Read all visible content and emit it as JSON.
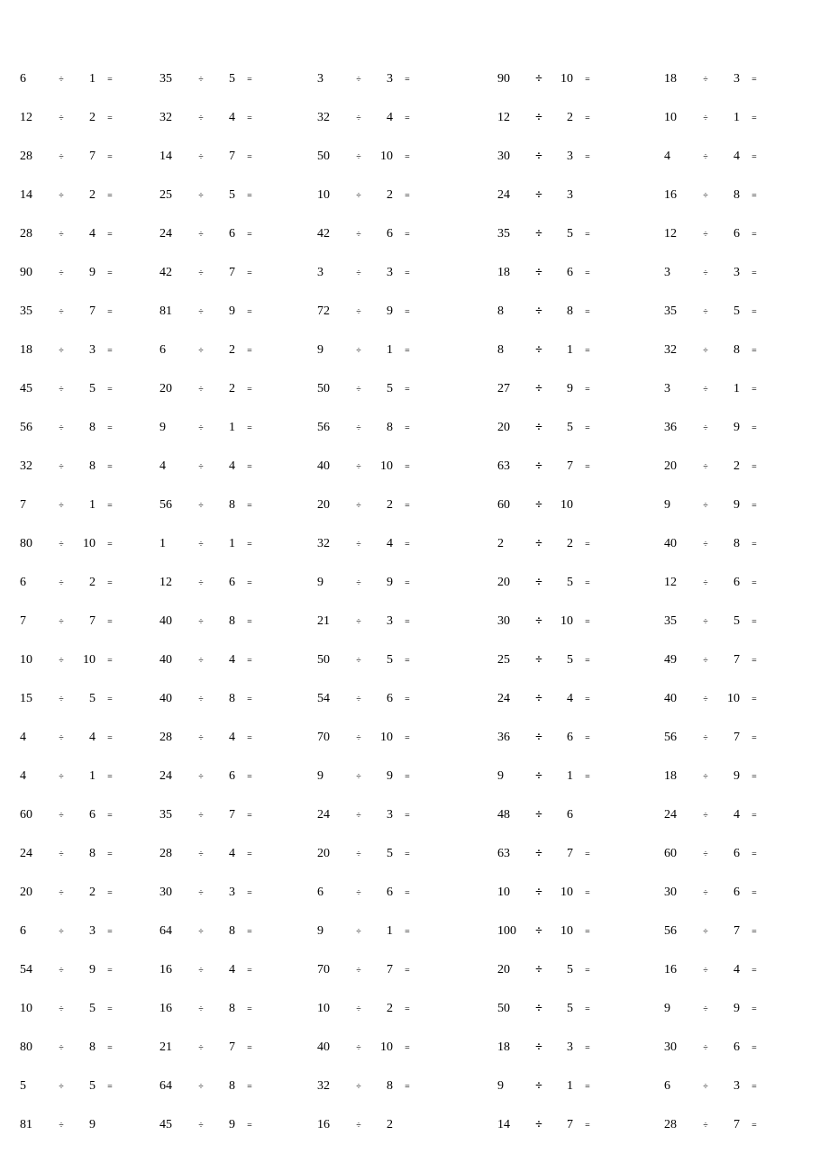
{
  "worksheet": {
    "rows": [
      [
        {
          "a": "6",
          "op": "÷",
          "b": "1",
          "eq": "="
        },
        {
          "a": "35",
          "op": "÷",
          "b": "5",
          "eq": "="
        },
        {
          "a": "3",
          "op": "÷",
          "b": "3",
          "eq": "="
        },
        {
          "a": "90",
          "op": "÷",
          "b": "10",
          "eq": "="
        },
        {
          "a": "18",
          "op": "÷",
          "b": "3",
          "eq": "="
        }
      ],
      [
        {
          "a": "12",
          "op": "÷",
          "b": "2",
          "eq": "="
        },
        {
          "a": "32",
          "op": "÷",
          "b": "4",
          "eq": "="
        },
        {
          "a": "32",
          "op": "÷",
          "b": "4",
          "eq": "="
        },
        {
          "a": "12",
          "op": "÷",
          "b": "2",
          "eq": "="
        },
        {
          "a": "10",
          "op": "÷",
          "b": "1",
          "eq": "="
        }
      ],
      [
        {
          "a": "28",
          "op": "÷",
          "b": "7",
          "eq": "="
        },
        {
          "a": "14",
          "op": "÷",
          "b": "7",
          "eq": "="
        },
        {
          "a": "50",
          "op": "÷",
          "b": "10",
          "eq": "="
        },
        {
          "a": "30",
          "op": "÷",
          "b": "3",
          "eq": "="
        },
        {
          "a": "4",
          "op": "÷",
          "b": "4",
          "eq": "="
        }
      ],
      [
        {
          "a": "14",
          "op": "÷",
          "b": "2",
          "eq": "="
        },
        {
          "a": "25",
          "op": "÷",
          "b": "5",
          "eq": "="
        },
        {
          "a": "10",
          "op": "÷",
          "b": "2",
          "eq": "="
        },
        {
          "a": "24",
          "op": "÷",
          "b": "3",
          "eq": ""
        },
        {
          "a": "16",
          "op": "÷",
          "b": "8",
          "eq": "="
        }
      ],
      [
        {
          "a": "28",
          "op": "÷",
          "b": "4",
          "eq": "="
        },
        {
          "a": "24",
          "op": "÷",
          "b": "6",
          "eq": "="
        },
        {
          "a": "42",
          "op": "÷",
          "b": "6",
          "eq": "="
        },
        {
          "a": "35",
          "op": "÷",
          "b": "5",
          "eq": "="
        },
        {
          "a": "12",
          "op": "÷",
          "b": "6",
          "eq": "="
        }
      ],
      [
        {
          "a": "90",
          "op": "÷",
          "b": "9",
          "eq": "="
        },
        {
          "a": "42",
          "op": "÷",
          "b": "7",
          "eq": "="
        },
        {
          "a": "3",
          "op": "÷",
          "b": "3",
          "eq": "="
        },
        {
          "a": "18",
          "op": "÷",
          "b": "6",
          "eq": "="
        },
        {
          "a": "3",
          "op": "÷",
          "b": "3",
          "eq": "="
        }
      ],
      [
        {
          "a": "35",
          "op": "÷",
          "b": "7",
          "eq": "="
        },
        {
          "a": "81",
          "op": "÷",
          "b": "9",
          "eq": "="
        },
        {
          "a": "72",
          "op": "÷",
          "b": "9",
          "eq": "="
        },
        {
          "a": "8",
          "op": "÷",
          "b": "8",
          "eq": "="
        },
        {
          "a": "35",
          "op": "÷",
          "b": "5",
          "eq": "="
        }
      ],
      [
        {
          "a": "18",
          "op": "÷",
          "b": "3",
          "eq": "="
        },
        {
          "a": "6",
          "op": "÷",
          "b": "2",
          "eq": "="
        },
        {
          "a": "9",
          "op": "÷",
          "b": "1",
          "eq": "="
        },
        {
          "a": "8",
          "op": "÷",
          "b": "1",
          "eq": "="
        },
        {
          "a": "32",
          "op": "÷",
          "b": "8",
          "eq": "="
        }
      ],
      [
        {
          "a": "45",
          "op": "÷",
          "b": "5",
          "eq": "="
        },
        {
          "a": "20",
          "op": "÷",
          "b": "2",
          "eq": "="
        },
        {
          "a": "50",
          "op": "÷",
          "b": "5",
          "eq": "="
        },
        {
          "a": "27",
          "op": "÷",
          "b": "9",
          "eq": "="
        },
        {
          "a": "3",
          "op": "÷",
          "b": "1",
          "eq": "="
        }
      ],
      [
        {
          "a": "56",
          "op": "÷",
          "b": "8",
          "eq": "="
        },
        {
          "a": "9",
          "op": "÷",
          "b": "1",
          "eq": "="
        },
        {
          "a": "56",
          "op": "÷",
          "b": "8",
          "eq": "="
        },
        {
          "a": "20",
          "op": "÷",
          "b": "5",
          "eq": "="
        },
        {
          "a": "36",
          "op": "÷",
          "b": "9",
          "eq": "="
        }
      ],
      [
        {
          "a": "32",
          "op": "÷",
          "b": "8",
          "eq": "="
        },
        {
          "a": "4",
          "op": "÷",
          "b": "4",
          "eq": "="
        },
        {
          "a": "40",
          "op": "÷",
          "b": "10",
          "eq": "="
        },
        {
          "a": "63",
          "op": "÷",
          "b": "7",
          "eq": "="
        },
        {
          "a": "20",
          "op": "÷",
          "b": "2",
          "eq": "="
        }
      ],
      [
        {
          "a": "7",
          "op": "÷",
          "b": "1",
          "eq": "="
        },
        {
          "a": "56",
          "op": "÷",
          "b": "8",
          "eq": "="
        },
        {
          "a": "20",
          "op": "÷",
          "b": "2",
          "eq": "="
        },
        {
          "a": "60",
          "op": "÷",
          "b": "10",
          "eq": ""
        },
        {
          "a": "9",
          "op": "÷",
          "b": "9",
          "eq": "="
        }
      ],
      [
        {
          "a": "80",
          "op": "÷",
          "b": "10",
          "eq": "="
        },
        {
          "a": "1",
          "op": "÷",
          "b": "1",
          "eq": "="
        },
        {
          "a": "32",
          "op": "÷",
          "b": "4",
          "eq": "="
        },
        {
          "a": "2",
          "op": "÷",
          "b": "2",
          "eq": "="
        },
        {
          "a": "40",
          "op": "÷",
          "b": "8",
          "eq": "="
        }
      ],
      [
        {
          "a": "6",
          "op": "÷",
          "b": "2",
          "eq": "="
        },
        {
          "a": "12",
          "op": "÷",
          "b": "6",
          "eq": "="
        },
        {
          "a": "9",
          "op": "÷",
          "b": "9",
          "eq": "="
        },
        {
          "a": "20",
          "op": "÷",
          "b": "5",
          "eq": "="
        },
        {
          "a": "12",
          "op": "÷",
          "b": "6",
          "eq": "="
        }
      ],
      [
        {
          "a": "7",
          "op": "÷",
          "b": "7",
          "eq": "="
        },
        {
          "a": "40",
          "op": "÷",
          "b": "8",
          "eq": "="
        },
        {
          "a": "21",
          "op": "÷",
          "b": "3",
          "eq": "="
        },
        {
          "a": "30",
          "op": "÷",
          "b": "10",
          "eq": "="
        },
        {
          "a": "35",
          "op": "÷",
          "b": "5",
          "eq": "="
        }
      ],
      [
        {
          "a": "10",
          "op": "÷",
          "b": "10",
          "eq": "="
        },
        {
          "a": "40",
          "op": "÷",
          "b": "4",
          "eq": "="
        },
        {
          "a": "50",
          "op": "÷",
          "b": "5",
          "eq": "="
        },
        {
          "a": "25",
          "op": "÷",
          "b": "5",
          "eq": "="
        },
        {
          "a": "49",
          "op": "÷",
          "b": "7",
          "eq": "="
        }
      ],
      [
        {
          "a": "15",
          "op": "÷",
          "b": "5",
          "eq": "="
        },
        {
          "a": "40",
          "op": "÷",
          "b": "8",
          "eq": "="
        },
        {
          "a": "54",
          "op": "÷",
          "b": "6",
          "eq": "="
        },
        {
          "a": "24",
          "op": "÷",
          "b": "4",
          "eq": "="
        },
        {
          "a": "40",
          "op": "÷",
          "b": "10",
          "eq": "="
        }
      ],
      [
        {
          "a": "4",
          "op": "÷",
          "b": "4",
          "eq": "="
        },
        {
          "a": "28",
          "op": "÷",
          "b": "4",
          "eq": "="
        },
        {
          "a": "70",
          "op": "÷",
          "b": "10",
          "eq": "="
        },
        {
          "a": "36",
          "op": "÷",
          "b": "6",
          "eq": "="
        },
        {
          "a": "56",
          "op": "÷",
          "b": "7",
          "eq": "="
        }
      ],
      [
        {
          "a": "4",
          "op": "÷",
          "b": "1",
          "eq": "="
        },
        {
          "a": "24",
          "op": "÷",
          "b": "6",
          "eq": "="
        },
        {
          "a": "9",
          "op": "÷",
          "b": "9",
          "eq": "="
        },
        {
          "a": "9",
          "op": "÷",
          "b": "1",
          "eq": "="
        },
        {
          "a": "18",
          "op": "÷",
          "b": "9",
          "eq": "="
        }
      ],
      [
        {
          "a": "60",
          "op": "÷",
          "b": "6",
          "eq": "="
        },
        {
          "a": "35",
          "op": "÷",
          "b": "7",
          "eq": "="
        },
        {
          "a": "24",
          "op": "÷",
          "b": "3",
          "eq": "="
        },
        {
          "a": "48",
          "op": "÷",
          "b": "6",
          "eq": ""
        },
        {
          "a": "24",
          "op": "÷",
          "b": "4",
          "eq": "="
        }
      ],
      [
        {
          "a": "24",
          "op": "÷",
          "b": "8",
          "eq": "="
        },
        {
          "a": "28",
          "op": "÷",
          "b": "4",
          "eq": "="
        },
        {
          "a": "20",
          "op": "÷",
          "b": "5",
          "eq": "="
        },
        {
          "a": "63",
          "op": "÷",
          "b": "7",
          "eq": "="
        },
        {
          "a": "60",
          "op": "÷",
          "b": "6",
          "eq": "="
        }
      ],
      [
        {
          "a": "20",
          "op": "÷",
          "b": "2",
          "eq": "="
        },
        {
          "a": "30",
          "op": "÷",
          "b": "3",
          "eq": "="
        },
        {
          "a": "6",
          "op": "÷",
          "b": "6",
          "eq": "="
        },
        {
          "a": "10",
          "op": "÷",
          "b": "10",
          "eq": "="
        },
        {
          "a": "30",
          "op": "÷",
          "b": "6",
          "eq": "="
        }
      ],
      [
        {
          "a": "6",
          "op": "÷",
          "b": "3",
          "eq": "="
        },
        {
          "a": "64",
          "op": "÷",
          "b": "8",
          "eq": "="
        },
        {
          "a": "9",
          "op": "÷",
          "b": "1",
          "eq": "="
        },
        {
          "a": "100",
          "op": "÷",
          "b": "10",
          "eq": "="
        },
        {
          "a": "56",
          "op": "÷",
          "b": "7",
          "eq": "="
        }
      ],
      [
        {
          "a": "54",
          "op": "÷",
          "b": "9",
          "eq": "="
        },
        {
          "a": "16",
          "op": "÷",
          "b": "4",
          "eq": "="
        },
        {
          "a": "70",
          "op": "÷",
          "b": "7",
          "eq": "="
        },
        {
          "a": "20",
          "op": "÷",
          "b": "5",
          "eq": "="
        },
        {
          "a": "16",
          "op": "÷",
          "b": "4",
          "eq": "="
        }
      ],
      [
        {
          "a": "10",
          "op": "÷",
          "b": "5",
          "eq": "="
        },
        {
          "a": "16",
          "op": "÷",
          "b": "8",
          "eq": "="
        },
        {
          "a": "10",
          "op": "÷",
          "b": "2",
          "eq": "="
        },
        {
          "a": "50",
          "op": "÷",
          "b": "5",
          "eq": "="
        },
        {
          "a": "9",
          "op": "÷",
          "b": "9",
          "eq": "="
        }
      ],
      [
        {
          "a": "80",
          "op": "÷",
          "b": "8",
          "eq": "="
        },
        {
          "a": "21",
          "op": "÷",
          "b": "7",
          "eq": "="
        },
        {
          "a": "40",
          "op": "÷",
          "b": "10",
          "eq": "="
        },
        {
          "a": "18",
          "op": "÷",
          "b": "3",
          "eq": "="
        },
        {
          "a": "30",
          "op": "÷",
          "b": "6",
          "eq": "="
        }
      ],
      [
        {
          "a": "5",
          "op": "÷",
          "b": "5",
          "eq": "="
        },
        {
          "a": "64",
          "op": "÷",
          "b": "8",
          "eq": "="
        },
        {
          "a": "32",
          "op": "÷",
          "b": "8",
          "eq": "="
        },
        {
          "a": "9",
          "op": "÷",
          "b": "1",
          "eq": "="
        },
        {
          "a": "6",
          "op": "÷",
          "b": "3",
          "eq": "="
        }
      ],
      [
        {
          "a": "81",
          "op": "÷",
          "b": "9",
          "eq": ""
        },
        {
          "a": "45",
          "op": "÷",
          "b": "9",
          "eq": "="
        },
        {
          "a": "16",
          "op": "÷",
          "b": "2",
          "eq": ""
        },
        {
          "a": "14",
          "op": "÷",
          "b": "7",
          "eq": "="
        },
        {
          "a": "28",
          "op": "÷",
          "b": "7",
          "eq": "="
        }
      ]
    ]
  }
}
